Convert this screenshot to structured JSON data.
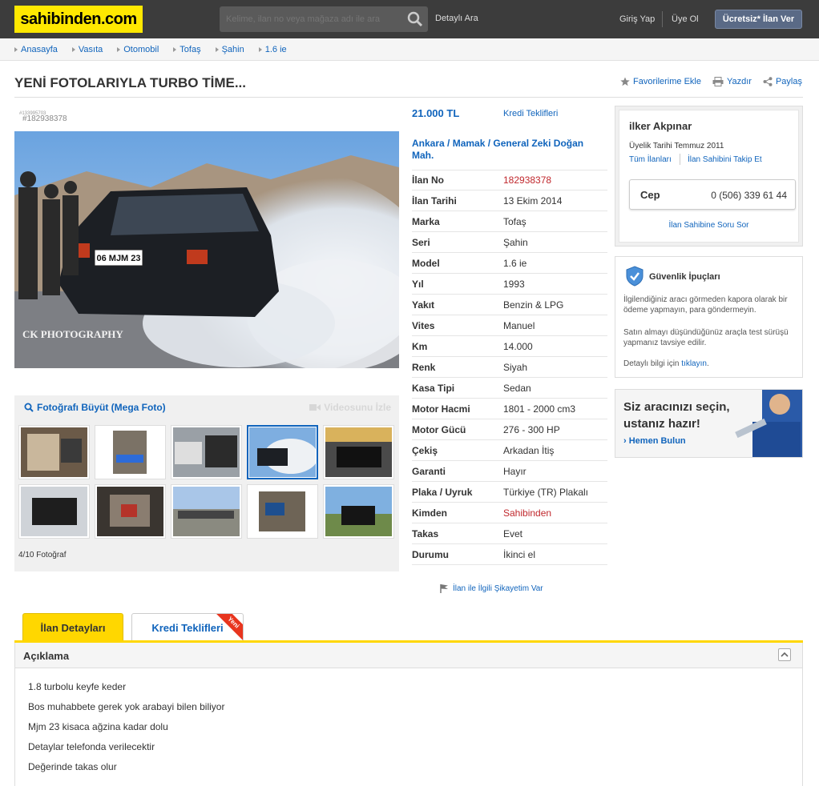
{
  "header": {
    "logo": "sahibinden.com",
    "search_placeholder": "Kelime, ilan no veya mağaza adı ile ara",
    "detailed_search": "Detaylı Ara",
    "login": "Giriş Yap",
    "register": "Üye Ol",
    "post_ad": "Ücretsiz* İlan Ver"
  },
  "breadcrumb": [
    "Anasayfa",
    "Vasıta",
    "Otomobil",
    "Tofaş",
    "Şahin",
    "1.6 ie"
  ],
  "title": "YENİ FOTOLARIYLA TURBO TİME...",
  "actions": {
    "favorite": "Favorilerime Ekle",
    "print": "Yazdır",
    "share": "Paylaş"
  },
  "photo": {
    "id_small": "#133995703",
    "id": "#182938378",
    "watermark": "CK PHOTOGRAPHY",
    "plate": "06 MJM 23",
    "enlarge": "Fotoğrafı Büyüt (Mega Foto)",
    "video": "Videosunu İzle",
    "count": "4/10 Fotoğraf"
  },
  "listing": {
    "price": "21.000 TL",
    "credit_offers": "Kredi Teklifleri",
    "location": [
      "Ankara",
      "Mamak",
      "General Zeki Doğan Mah."
    ],
    "specs": [
      {
        "key": "İlan No",
        "value": "182938378",
        "red": true
      },
      {
        "key": "İlan Tarihi",
        "value": "13 Ekim 2014"
      },
      {
        "key": "Marka",
        "value": "Tofaş"
      },
      {
        "key": "Seri",
        "value": "Şahin"
      },
      {
        "key": "Model",
        "value": "1.6 ie"
      },
      {
        "key": "Yıl",
        "value": "1993"
      },
      {
        "key": "Yakıt",
        "value": "Benzin & LPG"
      },
      {
        "key": "Vites",
        "value": "Manuel"
      },
      {
        "key": "Km",
        "value": "14.000"
      },
      {
        "key": "Renk",
        "value": "Siyah"
      },
      {
        "key": "Kasa Tipi",
        "value": "Sedan"
      },
      {
        "key": "Motor Hacmi",
        "value": "1801 - 2000 cm3"
      },
      {
        "key": "Motor Gücü",
        "value": "276 - 300 HP"
      },
      {
        "key": "Çekiş",
        "value": "Arkadan İtiş"
      },
      {
        "key": "Garanti",
        "value": "Hayır"
      },
      {
        "key": "Plaka / Uyruk",
        "value": "Türkiye (TR) Plakalı"
      },
      {
        "key": "Kimden",
        "value": "Sahibinden",
        "red": true
      },
      {
        "key": "Takas",
        "value": "Evet"
      },
      {
        "key": "Durumu",
        "value": "İkinci el"
      }
    ],
    "report": "İlan ile İlgili Şikayetim Var"
  },
  "seller": {
    "name": "ilker Akpınar",
    "membership": "Üyelik Tarihi  Temmuz 2011",
    "all_ads": "Tüm İlanları",
    "follow": "İlan Sahibini Takip Et",
    "phone_label": "Cep",
    "phone": "0 (506) 339 61 44",
    "ask": "İlan Sahibine Soru Sor"
  },
  "security": {
    "title": "Güvenlik İpuçları",
    "tip1": "İlgilendiğiniz aracı görmeden kapora olarak bir ödeme yapmayın, para göndermeyin.",
    "tip2": "Satın almayı düşündüğünüz araçla test sürüşü yapmanız tavsiye edilir.",
    "more_prefix": "Detaylı bilgi için",
    "more_link": "tıklayın",
    "more_suffix": "."
  },
  "ad": {
    "line1": "Siz aracınızı seçin,",
    "line2": "ustanız hazır!",
    "link": "Hemen Bulun"
  },
  "tabs": {
    "details": "İlan Detayları",
    "credit": "Kredi Teklifleri",
    "ribbon": "Yeni"
  },
  "description": {
    "heading": "Açıklama",
    "lines": [
      "1.8 turbolu keyfe keder",
      "Bos muhabbete gerek yok arabayi bilen biliyor",
      "Mjm 23 kisaca ağzina kadar dolu",
      "Detaylar telefonda verilecektir",
      "Değerinde takas olur"
    ]
  },
  "colors": {
    "brand_yellow": "#ffe800",
    "link_blue": "#1064bc",
    "alert_red": "#c0282d",
    "header_dark": "#3c3c3c"
  }
}
